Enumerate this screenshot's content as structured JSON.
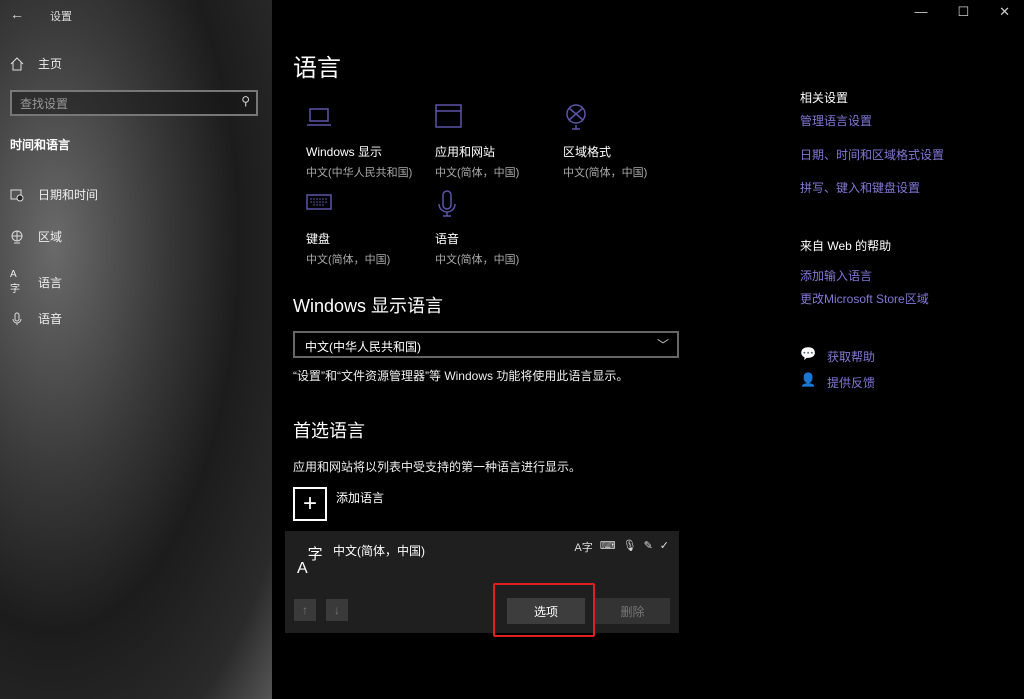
{
  "window": {
    "title": "设置",
    "controls": [
      "minimize",
      "maximize",
      "close"
    ]
  },
  "sidebar": {
    "home": "主页",
    "search_placeholder": "查找设置",
    "section": "时间和语言",
    "items": [
      {
        "label": "日期和时间",
        "icon": "calendar-clock-icon"
      },
      {
        "label": "区域",
        "icon": "globe-icon"
      },
      {
        "label": "语言",
        "icon": "language-icon"
      },
      {
        "label": "语音",
        "icon": "microphone-icon"
      }
    ]
  },
  "main": {
    "title": "语言",
    "tiles": [
      {
        "title": "Windows 显示",
        "sub": "中文(中华人民共和国)"
      },
      {
        "title": "应用和网站",
        "sub": "中文(简体，中国)"
      },
      {
        "title": "区域格式",
        "sub": "中文(简体，中国)"
      },
      {
        "title": "键盘",
        "sub": "中文(简体，中国)"
      },
      {
        "title": "语音",
        "sub": "中文(简体，中国)"
      }
    ],
    "display_lang_heading": "Windows 显示语言",
    "display_lang_value": "中文(中华人民共和国)",
    "display_lang_desc": "“设置”和“文件资源管理器”等 Windows 功能将使用此语言显示。",
    "preferred_heading": "首选语言",
    "preferred_desc": "应用和网站将以列表中受支持的第一种语言进行显示。",
    "add_language": "添加语言",
    "language_item": {
      "name": "中文(简体，中国)",
      "options": "选项",
      "remove": "删除"
    }
  },
  "right": {
    "related_heading": "相关设置",
    "related_links": [
      "管理语言设置",
      "日期、时间和区域格式设置",
      "拼写、键入和键盘设置"
    ],
    "web_help_heading": "来自 Web 的帮助",
    "web_links": [
      "添加输入语言",
      "更改Microsoft Store区域"
    ],
    "get_help": "获取帮助",
    "feedback": "提供反馈"
  },
  "colors": {
    "accent": "#8277d6",
    "icon": "#5e54a8",
    "highlight": "#e02020"
  }
}
